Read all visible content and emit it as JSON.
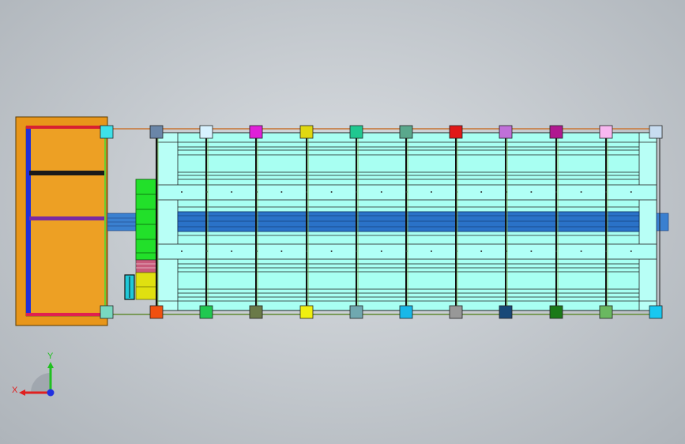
{
  "viewport": {
    "background": [
      "#d9dde1",
      "#c6cbd0",
      "#aeb4ba"
    ]
  },
  "colors": {
    "frame_orange": "#e8961a",
    "panel_cyan": "#a8fff2",
    "belt_blue": "#2a72c8",
    "green_block": "#22e02a",
    "yellow_block": "#e0e010",
    "edge": "#111111"
  },
  "top_blocks": [
    "#3ee0e8",
    "#6a86a8",
    "#d8f2ff",
    "#e020d8",
    "#e0d810",
    "#20c890",
    "#5aa88c",
    "#e01818",
    "#c070d8",
    "#b01890",
    "#f8b8f0",
    "#c8dcf0"
  ],
  "bottom_blocks": [
    "#78d8c0",
    "#f05010",
    "#20c850",
    "#6a7a48",
    "#f0f010",
    "#70a8b0",
    "#18b8e8",
    "#989898",
    "#184878",
    "#1a7a18",
    "#6ab860",
    "#18c8f0"
  ],
  "triad": {
    "x_label": "X",
    "y_label": "Y",
    "x_color": "#e02020",
    "y_color": "#20c020",
    "z_color": "#2030e0"
  }
}
